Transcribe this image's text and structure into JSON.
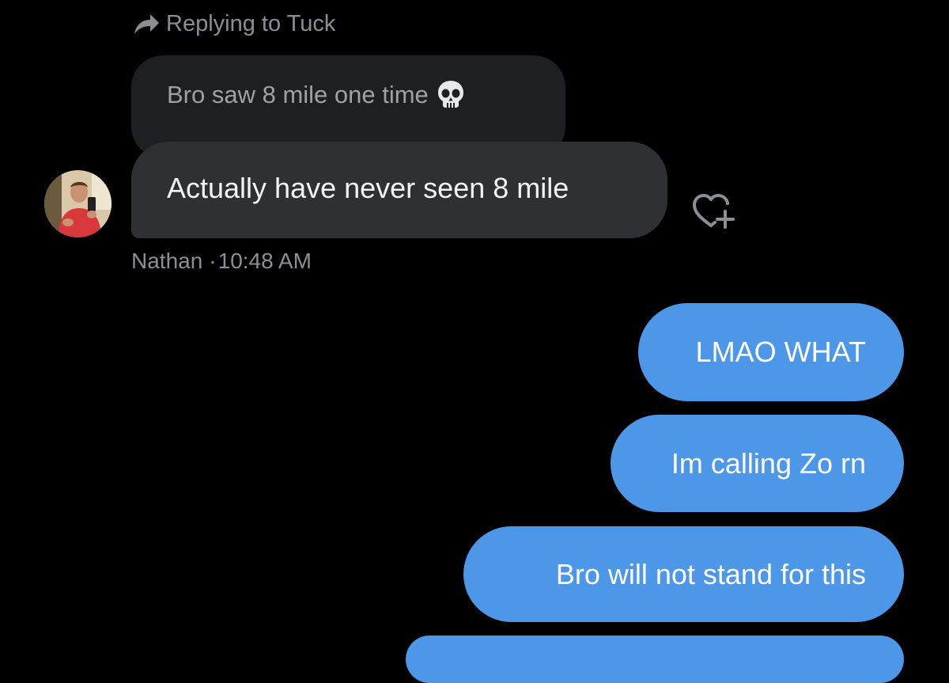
{
  "reply_header": {
    "text": "Replying to Tuck",
    "icon": "reply-arrow-icon"
  },
  "quoted_message": {
    "text": "Bro saw 8 mile one time",
    "emoji_icon": "skull-icon"
  },
  "incoming_message": {
    "text": "Actually have never seen 8 mile",
    "sender": "Nathan",
    "separator": "·",
    "time": "10:48 AM",
    "avatar_icon": "avatar",
    "reaction_icon": "add-reaction-heart-icon"
  },
  "outgoing_messages": [
    {
      "text": "LMAO WHAT"
    },
    {
      "text": "Im calling Zo rn"
    },
    {
      "text": "Bro will not stand for this"
    }
  ],
  "colors": {
    "background": "#000000",
    "incoming_bubble": "#2f3033",
    "quoted_bubble": "#1e1f21",
    "outgoing_bubble": "#4c97e8",
    "muted_text": "#8b8f94"
  }
}
